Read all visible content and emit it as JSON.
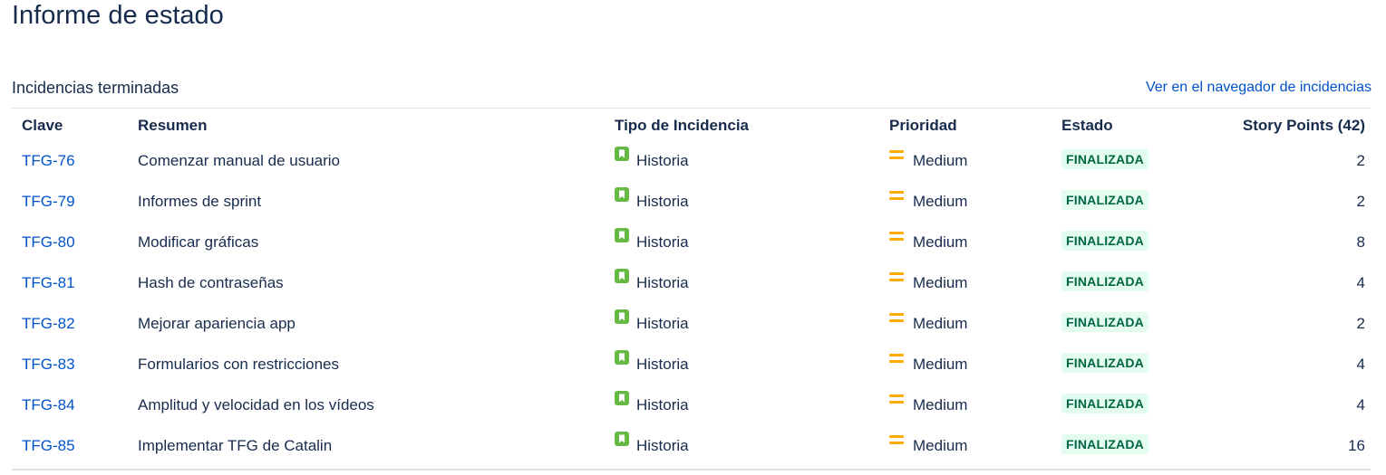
{
  "page": {
    "title": "Informe de estado"
  },
  "section": {
    "title": "Incidencias terminadas",
    "link": "Ver en el navegador de incidencias"
  },
  "table": {
    "headers": {
      "key": "Clave",
      "summary": "Resumen",
      "type": "Tipo de Incidencia",
      "priority": "Prioridad",
      "status": "Estado",
      "story_points": "Story Points (42)"
    },
    "rows": [
      {
        "key": "TFG-76",
        "summary": "Comenzar manual de usuario",
        "type": "Historia",
        "priority": "Medium",
        "status": "FINALIZADA",
        "story_points": "2"
      },
      {
        "key": "TFG-79",
        "summary": "Informes de sprint",
        "type": "Historia",
        "priority": "Medium",
        "status": "FINALIZADA",
        "story_points": "2"
      },
      {
        "key": "TFG-80",
        "summary": "Modificar gráficas",
        "type": "Historia",
        "priority": "Medium",
        "status": "FINALIZADA",
        "story_points": "8"
      },
      {
        "key": "TFG-81",
        "summary": "Hash de contraseñas",
        "type": "Historia",
        "priority": "Medium",
        "status": "FINALIZADA",
        "story_points": "4"
      },
      {
        "key": "TFG-82",
        "summary": "Mejorar apariencia app",
        "type": "Historia",
        "priority": "Medium",
        "status": "FINALIZADA",
        "story_points": "2"
      },
      {
        "key": "TFG-83",
        "summary": "Formularios con restricciones",
        "type": "Historia",
        "priority": "Medium",
        "status": "FINALIZADA",
        "story_points": "4"
      },
      {
        "key": "TFG-84",
        "summary": "Amplitud y velocidad en los vídeos",
        "type": "Historia",
        "priority": "Medium",
        "status": "FINALIZADA",
        "story_points": "4"
      },
      {
        "key": "TFG-85",
        "summary": "Implementar TFG de Catalin",
        "type": "Historia",
        "priority": "Medium",
        "status": "FINALIZADA",
        "story_points": "16"
      }
    ]
  },
  "icons": {
    "type": "story-icon",
    "priority": "priority-medium-icon"
  },
  "colors": {
    "link": "#0052cc",
    "story_icon": "#65ba43",
    "priority_medium": "#ffab00",
    "status_done_bg": "#e3fcef",
    "status_done_text": "#006644",
    "text": "#172b4d"
  }
}
